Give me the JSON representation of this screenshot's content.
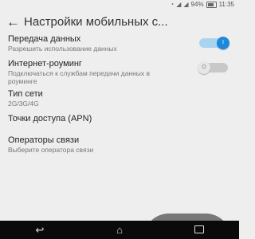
{
  "status_bar": {
    "battery": "94%",
    "time": "11:35",
    "icons": [
      "wifi-icon",
      "signal-icon",
      "battery-icon"
    ]
  },
  "app_bar": {
    "back_icon": "back-arrow-icon",
    "title": "Настройки мобильных с..."
  },
  "settings": [
    {
      "title": "Передача данных",
      "subtitle": "Разрешить использование данных",
      "toggle": "on",
      "knob_label": "I"
    },
    {
      "title": "Интернет-роуминг",
      "subtitle": "Подключаться к службам передачи данных в роуминге",
      "toggle": "off",
      "knob_label": "O"
    },
    {
      "title": "Тип сети",
      "subtitle": "2G/3G/4G"
    },
    {
      "title": "Точки доступа (APN)"
    },
    {
      "title": "Операторы связи",
      "subtitle": "Выберите оператора связи"
    }
  ],
  "nav_bar": {
    "back": "back-icon",
    "home": "home-icon",
    "recent": "recent-apps-icon"
  },
  "colors": {
    "accent": "#1e88d9",
    "background": "#eeeeee",
    "nav": "#0a0a0a"
  }
}
